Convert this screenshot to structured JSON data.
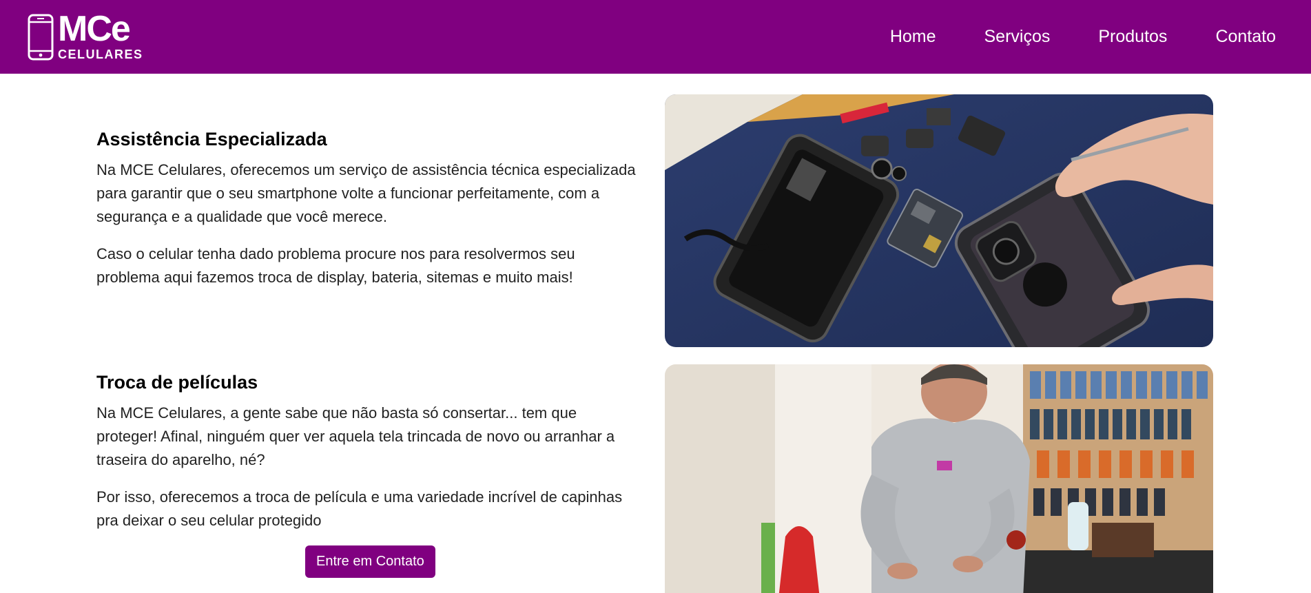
{
  "header": {
    "logo": {
      "main": "MCe",
      "sub": "CELULARES"
    },
    "nav": [
      {
        "label": "Home"
      },
      {
        "label": "Serviços"
      },
      {
        "label": "Produtos"
      },
      {
        "label": "Contato"
      }
    ]
  },
  "sections": [
    {
      "title": "Assistência Especializada",
      "paragraphs": [
        "Na MCE Celulares, oferecemos um serviço de assistência técnica especializada para garantir que o seu smartphone volte a funcionar perfeitamente, com a segurança e a qualidade que você merece.",
        "Caso o celular tenha dado problema procure nos para resolvermos seu problema aqui fazemos troca de display, bateria, sitemas e muito mais!"
      ]
    },
    {
      "title": "Troca de películas",
      "paragraphs": [
        "Na MCE Celulares, a gente sabe que não basta só consertar... tem que proteger! Afinal, ninguém quer ver aquela tela trincada de novo ou arranhar a traseira do aparelho, né?",
        "Por isso, oferecemos a troca de película e uma variedade incrível de capinhas pra deixar o seu celular protegido"
      ],
      "button_label": "Entre em Contato"
    }
  ],
  "colors": {
    "brand": "#800080",
    "text": "#222222"
  }
}
